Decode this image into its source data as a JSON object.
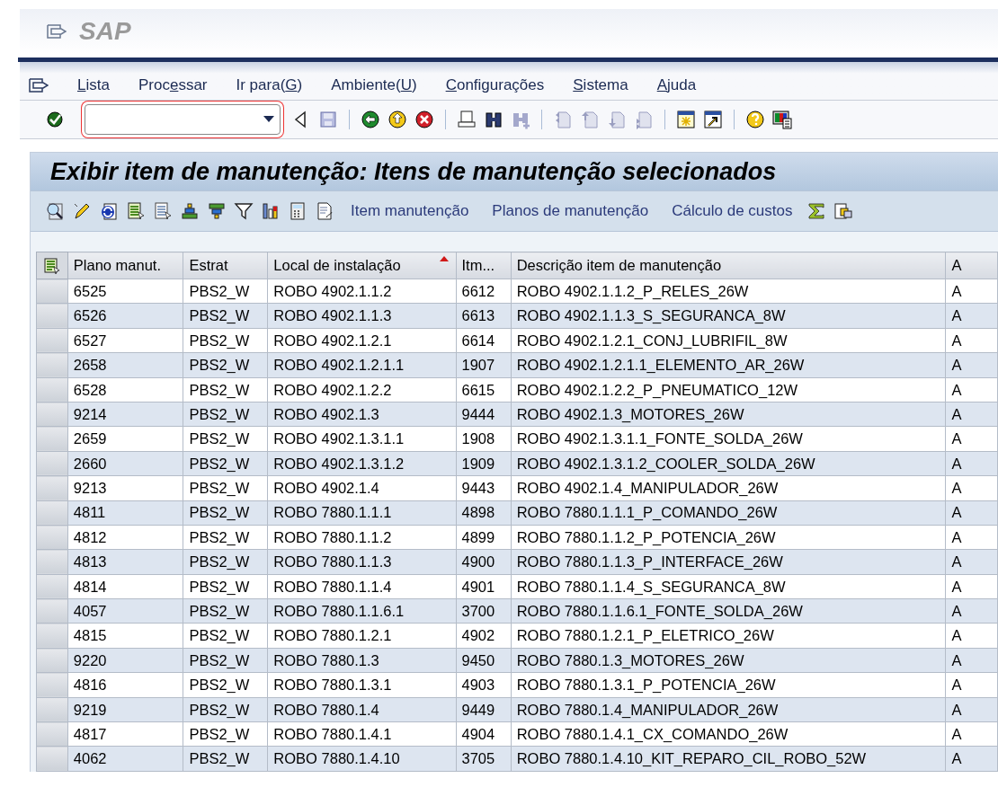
{
  "header": {
    "title": "SAP"
  },
  "menu": [
    {
      "key": "L",
      "post": "ista"
    },
    {
      "pre": "Proc",
      "key": "e",
      "post": "ssar"
    },
    {
      "pre": "Ir para(",
      "key": "G",
      "post": ")"
    },
    {
      "pre": "Ambiente(",
      "key": "U",
      "post": ")"
    },
    {
      "key": "C",
      "post": "onfigurações"
    },
    {
      "key": "S",
      "post": "istema"
    },
    {
      "key": "A",
      "post": "juda"
    }
  ],
  "screen_title": "Exibir item de manutenção: Itens de manutenção selecionados",
  "app_toolbar_buttons": [
    "Item manutenção",
    "Planos de manutenção",
    "Cálculo de custos"
  ],
  "table": {
    "columns": [
      {
        "label": "Plano manut.",
        "sorted": false
      },
      {
        "label": "Estrat",
        "sorted": false
      },
      {
        "label": "Local de instalação",
        "sorted": true
      },
      {
        "label": "Itm...",
        "sorted": false
      },
      {
        "label": "Descrição item de manutenção",
        "sorted": false
      },
      {
        "label": "A",
        "sorted": false
      }
    ],
    "rows": [
      [
        "6525",
        "PBS2_W",
        "ROBO 4902.1.1.2",
        "6612",
        "ROBO 4902.1.1.2_P_RELES_26W",
        "A"
      ],
      [
        "6526",
        "PBS2_W",
        "ROBO 4902.1.1.3",
        "6613",
        "ROBO 4902.1.1.3_S_SEGURANCA_8W",
        "A"
      ],
      [
        "6527",
        "PBS2_W",
        "ROBO 4902.1.2.1",
        "6614",
        "ROBO 4902.1.2.1_CONJ_LUBRIFIL_8W",
        "A"
      ],
      [
        "2658",
        "PBS2_W",
        "ROBO 4902.1.2.1.1",
        "1907",
        "ROBO 4902.1.2.1.1_ELEMENTO_AR_26W",
        "A"
      ],
      [
        "6528",
        "PBS2_W",
        "ROBO 4902.1.2.2",
        "6615",
        "ROBO 4902.1.2.2_P_PNEUMATICO_12W",
        "A"
      ],
      [
        "9214",
        "PBS2_W",
        "ROBO 4902.1.3",
        "9444",
        "ROBO 4902.1.3_MOTORES_26W",
        "A"
      ],
      [
        "2659",
        "PBS2_W",
        "ROBO 4902.1.3.1.1",
        "1908",
        "ROBO 4902.1.3.1.1_FONTE_SOLDA_26W",
        "A"
      ],
      [
        "2660",
        "PBS2_W",
        "ROBO 4902.1.3.1.2",
        "1909",
        "ROBO 4902.1.3.1.2_COOLER_SOLDA_26W",
        "A"
      ],
      [
        "9213",
        "PBS2_W",
        "ROBO 4902.1.4",
        "9443",
        "ROBO 4902.1.4_MANIPULADOR_26W",
        "A"
      ],
      [
        "4811",
        "PBS2_W",
        "ROBO 7880.1.1.1",
        "4898",
        "ROBO 7880.1.1.1_P_COMANDO_26W",
        "A"
      ],
      [
        "4812",
        "PBS2_W",
        "ROBO 7880.1.1.2",
        "4899",
        "ROBO 7880.1.1.2_P_POTENCIA_26W",
        "A"
      ],
      [
        "4813",
        "PBS2_W",
        "ROBO 7880.1.1.3",
        "4900",
        "ROBO 7880.1.1.3_P_INTERFACE_26W",
        "A"
      ],
      [
        "4814",
        "PBS2_W",
        "ROBO 7880.1.1.4",
        "4901",
        "ROBO 7880.1.1.4_S_SEGURANCA_8W",
        "A"
      ],
      [
        "4057",
        "PBS2_W",
        "ROBO 7880.1.1.6.1",
        "3700",
        "ROBO 7880.1.1.6.1_FONTE_SOLDA_26W",
        "A"
      ],
      [
        "4815",
        "PBS2_W",
        "ROBO 7880.1.2.1",
        "4902",
        "ROBO 7880.1.2.1_P_ELETRICO_26W",
        "A"
      ],
      [
        "9220",
        "PBS2_W",
        "ROBO 7880.1.3",
        "9450",
        "ROBO 7880.1.3_MOTORES_26W",
        "A"
      ],
      [
        "4816",
        "PBS2_W",
        "ROBO 7880.1.3.1",
        "4903",
        "ROBO 7880.1.3.1_P_POTENCIA_26W",
        "A"
      ],
      [
        "9219",
        "PBS2_W",
        "ROBO 7880.1.4",
        "9449",
        "ROBO 7880.1.4_MANIPULADOR_26W",
        "A"
      ],
      [
        "4817",
        "PBS2_W",
        "ROBO 7880.1.4.1",
        "4904",
        "ROBO 7880.1.4.1_CX_COMANDO_26W",
        "A"
      ],
      [
        "4062",
        "PBS2_W",
        "ROBO 7880.1.4.10",
        "3705",
        "ROBO 7880.1.4.10_KIT_REPARO_CIL_ROBO_52W",
        "A"
      ]
    ]
  }
}
